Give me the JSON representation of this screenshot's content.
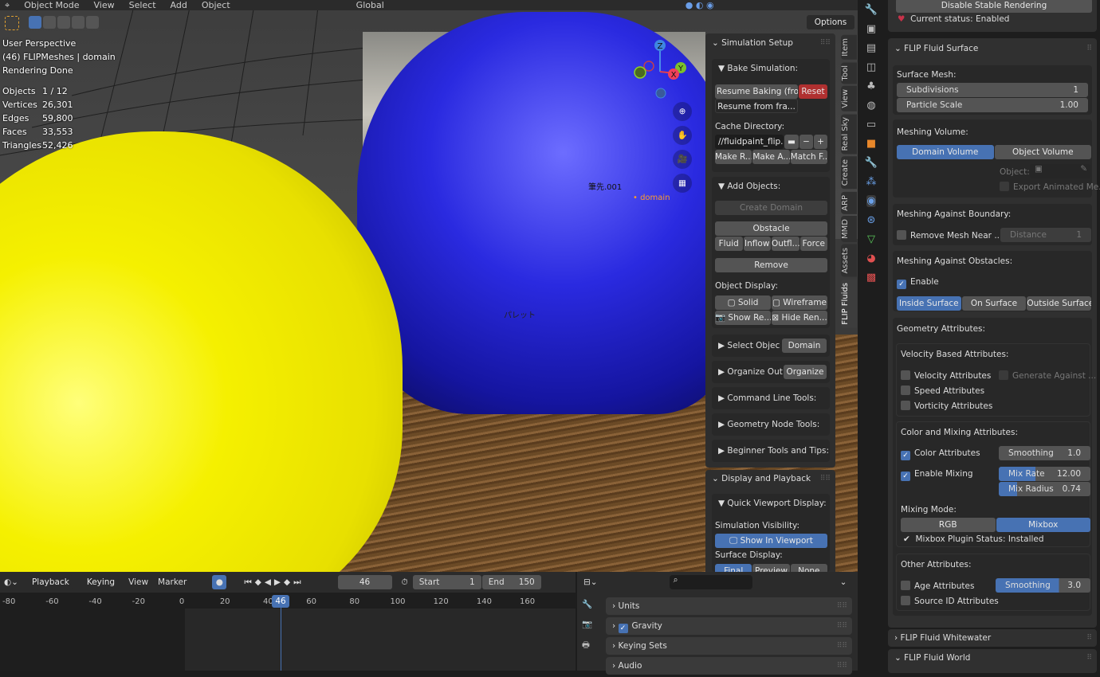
{
  "header": {
    "editor_icon": "view3d-icon",
    "mode": "Object Mode",
    "menus": [
      "View",
      "Select",
      "Add",
      "Object"
    ],
    "transform_orientation": "Global",
    "options": "Options"
  },
  "viewport": {
    "perspective": "User Perspective",
    "object_info": "(46) FLIPMeshes | domain",
    "render_status": "Rendering Done",
    "stats": [
      {
        "label": "Objects",
        "value": "1 / 12"
      },
      {
        "label": "Vertices",
        "value": "26,301"
      },
      {
        "label": "Edges",
        "value": "59,800"
      },
      {
        "label": "Faces",
        "value": "33,553"
      },
      {
        "label": "Triangles",
        "value": "52,426"
      }
    ],
    "labels": {
      "brush": "筆先.001",
      "domain": "domain",
      "palette": "パレット"
    },
    "gizmo": {
      "x": "X",
      "y": "Y",
      "z": "Z"
    }
  },
  "sidebar": {
    "tabs": [
      "Item",
      "Tool",
      "View",
      "Real Sky",
      "Create",
      "ARP",
      "MMD",
      "Assets",
      "FLIP Fluids"
    ],
    "simulation_setup": {
      "title": "Simulation Setup",
      "bake_title": "Bake Simulation:",
      "resume": "Resume Baking  (fro...",
      "reset": "Reset",
      "resume_from": "Resume from fra...",
      "cache_label": "Cache Directory:",
      "cache_path": "//fluidpaint_flip...",
      "cache_buttons": [
        "Make R...",
        "Make A...",
        "Match F..."
      ],
      "add_objects": "Add Objects:",
      "create_domain": "Create Domain",
      "obstacle": "Obstacle",
      "types": [
        "Fluid",
        "Inflow",
        "Outfl...",
        "Force"
      ],
      "remove": "Remove",
      "object_display": "Object Display:",
      "solid": "Solid",
      "wireframe": "Wireframe",
      "show_render": "Show Re...",
      "hide_render": "Hide Ren...",
      "select_object": "Select Objec",
      "domain": "Domain",
      "organize_outliner": "Organize Out...",
      "organize": "Organize",
      "collapsed": [
        "Command Line Tools:",
        "Geometry Node Tools:",
        "Beginner Tools and Tips:"
      ]
    },
    "display_playback": {
      "title": "Display and Playback",
      "quick": "Quick Viewport Display:",
      "sim_vis": "Simulation Visibility:",
      "show_viewport": "Show In Viewport",
      "surface_display": "Surface Display:",
      "surface_options": [
        "Final",
        "Preview",
        "None"
      ]
    }
  },
  "timeline": {
    "editor_icon": "clock-icon",
    "menus": [
      "Playback",
      "Keying",
      "View",
      "Marker"
    ],
    "current_frame": "46",
    "start_label": "Start",
    "start": "1",
    "end_label": "End",
    "end": "150",
    "ticks": [
      "-80",
      "-60",
      "-40",
      "-20",
      "0",
      "20",
      "40",
      "60",
      "80",
      "100",
      "120",
      "140",
      "160"
    ]
  },
  "lower_props": {
    "search_placeholder": "",
    "panels": [
      {
        "label": "Units"
      },
      {
        "label": "Gravity",
        "checked": true
      },
      {
        "label": "Keying Sets"
      },
      {
        "label": "Audio"
      }
    ]
  },
  "properties": {
    "disable_stable": "Disable Stable Rendering",
    "status": "Current status: Enabled",
    "surface_title": "FLIP Fluid Surface",
    "surface_mesh": "Surface Mesh:",
    "subdivisions": {
      "label": "Subdivisions",
      "value": "1"
    },
    "particle_scale": {
      "label": "Particle Scale",
      "value": "1.00"
    },
    "meshing_volume": "Meshing Volume:",
    "domain_volume": "Domain Volume",
    "object_volume": "Object Volume",
    "object_label": "Object:",
    "export_animated": "Export Animated Me...",
    "boundary": "Meshing Against Boundary:",
    "remove_mesh_near": "Remove Mesh Near ...",
    "distance": {
      "label": "Distance",
      "value": "1"
    },
    "obstacles": "Meshing Against Obstacles:",
    "enable": "Enable",
    "surface_modes": [
      "Inside Surface",
      "On Surface",
      "Outside Surface"
    ],
    "geometry_attributes": "Geometry Attributes:",
    "velocity_based": "Velocity Based Attributes:",
    "velocity_attr": "Velocity Attributes",
    "generate_against": "Generate Against ...",
    "speed_attr": "Speed Attributes",
    "vorticity_attr": "Vorticity Attributes",
    "color_mixing": "Color and Mixing Attributes:",
    "color_attr": "Color Attributes",
    "smoothing": {
      "label": "Smoothing",
      "value": "1.0"
    },
    "enable_mixing": "Enable Mixing",
    "mix_rate": {
      "label": "Mix Rate",
      "value": "12.00",
      "fill": 0.4
    },
    "mix_radius": {
      "label": "Mix Radius",
      "value": "0.74",
      "fill": 0.2
    },
    "mixing_mode": "Mixing Mode:",
    "modes": [
      "RGB",
      "Mixbox"
    ],
    "mixbox_status": "Mixbox Plugin Status: Installed",
    "other_attributes": "Other Attributes:",
    "age_attr": "Age Attributes",
    "age_smoothing": {
      "label": "Smoothing",
      "value": "3.0",
      "fill": 0.67
    },
    "source_id": "Source ID Attributes",
    "whitewater": "FLIP Fluid Whitewater",
    "world": "FLIP Fluid World"
  },
  "colors": {
    "accent": "#4772b3",
    "reset": "#b03030",
    "heart": "#c8324a",
    "domain_label": "#ff9c2a"
  }
}
